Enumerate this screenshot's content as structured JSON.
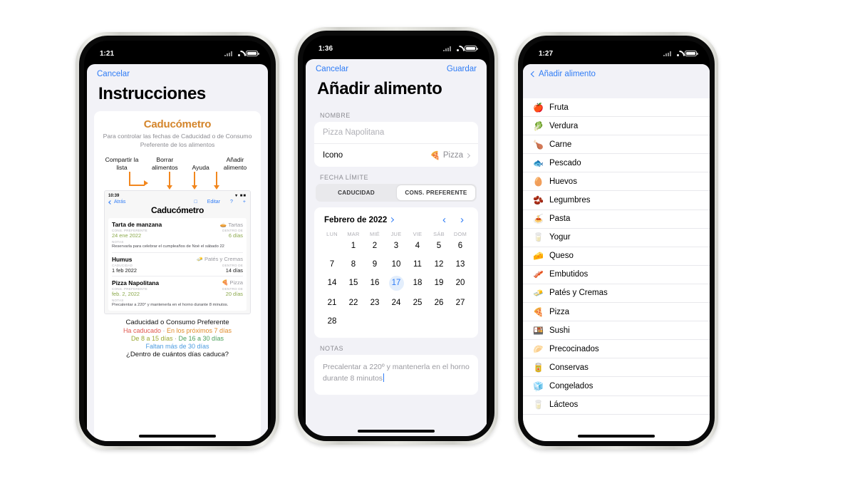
{
  "phones": [
    {
      "id": "phone-instructions",
      "status": {
        "time": "1:21"
      },
      "nav": {
        "cancel": "Cancelar"
      },
      "title": "Instrucciones",
      "card": {
        "brand": "Caducómetro",
        "subtitle": "Para controlar las fechas de Caducidad o de Consumo Preferente de los alimentos",
        "callouts": [
          "Compartir la lista",
          "Borrar alimentos",
          "Ayuda",
          "Añadir alimento"
        ],
        "mini": {
          "time": "10:39",
          "back": "Atrás",
          "edit": "Editar",
          "help": "?",
          "add": "+",
          "title": "Caducómetro",
          "items": [
            {
              "name": "Tarta de manzana",
              "category": "Tartas",
              "category_icon": "🥧",
              "date_label": "CONS. PREFERENTE",
              "date": "24 ene 2022",
              "days_label": "DENTRO DE",
              "days": "6 días",
              "color": "#8aa84a",
              "notes_label": "NOTAS",
              "notes": "Reservarla para celebrar el cumpleaños de Noé el sábado 22"
            },
            {
              "name": "Humus",
              "category": "Patés y Cremas",
              "category_icon": "🧈",
              "date_label": "CADUCIDAD",
              "date": "1 feb 2022",
              "days_label": "DENTRO DE",
              "days": "14 días",
              "color": "#1a1a1a",
              "notes_label": "",
              "notes": ""
            },
            {
              "name": "Pizza Napolitana",
              "category": "Pizza",
              "category_icon": "🍕",
              "date_label": "CONS. PREFERENTE",
              "date": "feb. 2, 2022",
              "days_label": "DENTRO DE",
              "days": "20 días",
              "color": "#8aa84a",
              "notes_label": "NOTAS",
              "notes": "Precalentar a 220° y mantenerla en el horno durante 8 minutos."
            }
          ]
        },
        "legend": {
          "title": "Caducidad o Consumo Preferente",
          "line1_a": "Ha caducado",
          "line1_sep": "·",
          "line1_b": "En los próximos 7 días",
          "line2_a": "De 8 a 15 días",
          "line2_sep": "·",
          "line2_b": "De 16 a 30 días",
          "line3": "Faltan más de 30 días",
          "question": "¿Dentro de cuántos días caduca?",
          "colors": {
            "expired": "#e0584f",
            "soon7": "#e08b2b",
            "d8_15": "#9aa832",
            "d16_30": "#4aa05a",
            "more30": "#4a9be0"
          }
        }
      }
    },
    {
      "id": "phone-add-food",
      "status": {
        "time": "1:36"
      },
      "nav": {
        "cancel": "Cancelar",
        "save": "Guardar"
      },
      "title": "Añadir alimento",
      "sections": {
        "name_label": "NOMBRE",
        "name_placeholder": "Pizza Napolitana",
        "icon_row_label": "Icono",
        "icon_row_value": "Pizza",
        "icon_row_emoji": "🍕",
        "date_label": "FECHA LÍMITE",
        "segments": [
          {
            "label": "CADUCIDAD",
            "selected": false
          },
          {
            "label": "CONS. PREFERENTE",
            "selected": true
          }
        ],
        "calendar": {
          "month": "Febrero de 2022",
          "prev": "‹",
          "next": "›",
          "dow": [
            "LUN",
            "MAR",
            "MIÉ",
            "JUE",
            "VIE",
            "SÁB",
            "DOM"
          ],
          "lead_blanks": 1,
          "days": [
            1,
            2,
            3,
            4,
            5,
            6,
            7,
            8,
            9,
            10,
            11,
            12,
            13,
            14,
            15,
            16,
            17,
            18,
            19,
            20,
            21,
            22,
            23,
            24,
            25,
            26,
            27,
            28
          ],
          "selected": 17
        },
        "notes_label": "NOTAS",
        "notes_text": "Precalentar a 220º y mantenerla en el horno durante 8 minutos"
      }
    },
    {
      "id": "phone-icon-picker",
      "status": {
        "time": "1:27"
      },
      "nav": {
        "back": "Añadir alimento"
      },
      "items": [
        {
          "emoji": "🍎",
          "label": "Fruta"
        },
        {
          "emoji": "🥬",
          "label": "Verdura"
        },
        {
          "emoji": "🍗",
          "label": "Carne"
        },
        {
          "emoji": "🐟",
          "label": "Pescado"
        },
        {
          "emoji": "🥚",
          "label": "Huevos"
        },
        {
          "emoji": "🫘",
          "label": "Legumbres"
        },
        {
          "emoji": "🍝",
          "label": "Pasta"
        },
        {
          "emoji": "🥛",
          "label": "Yogur"
        },
        {
          "emoji": "🧀",
          "label": "Queso"
        },
        {
          "emoji": "🥓",
          "label": "Embutidos"
        },
        {
          "emoji": "🧈",
          "label": "Patés y Cremas"
        },
        {
          "emoji": "🍕",
          "label": "Pizza"
        },
        {
          "emoji": "🍱",
          "label": "Sushi"
        },
        {
          "emoji": "🥟",
          "label": "Precocinados"
        },
        {
          "emoji": "🥫",
          "label": "Conservas"
        },
        {
          "emoji": "🧊",
          "label": "Congelados"
        },
        {
          "emoji": "🥛",
          "label": "Lácteos"
        }
      ]
    }
  ]
}
